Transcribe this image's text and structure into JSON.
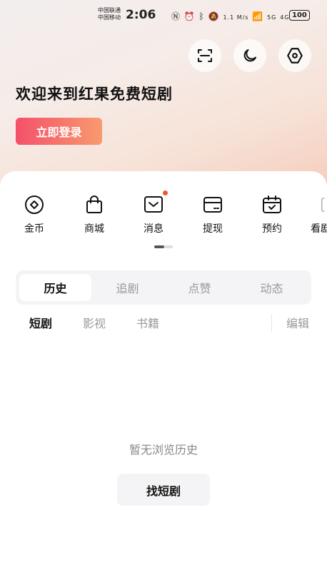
{
  "status_bar": {
    "carrier_1": "中国联通",
    "carrier_2": "中国移动",
    "time": "2:06",
    "speed": "1.1 M/s",
    "net_1": "5G",
    "net_2": "4G",
    "battery": "100"
  },
  "header": {
    "icons": [
      "scan-icon",
      "moon-icon",
      "settings-icon"
    ]
  },
  "welcome_text": "欢迎来到红果免费短剧",
  "login_label": "立即登录",
  "quick_actions": [
    {
      "label": "金币",
      "icon": "coin-icon"
    },
    {
      "label": "商城",
      "icon": "shopping-bag-icon"
    },
    {
      "label": "消息",
      "icon": "message-icon",
      "badge": true
    },
    {
      "label": "提现",
      "icon": "wallet-icon"
    },
    {
      "label": "预约",
      "icon": "calendar-icon"
    },
    {
      "label": "看剧",
      "icon": "tv-icon"
    }
  ],
  "tabs": [
    "历史",
    "追剧",
    "点赞",
    "动态"
  ],
  "active_tab": "历史",
  "sub_tabs": [
    "短剧",
    "影视",
    "书籍"
  ],
  "active_sub_tab": "短剧",
  "edit_label": "编辑",
  "empty_text": "暂无浏览历史",
  "find_button": "找短剧",
  "colors": {
    "accent_start": "#f4506b",
    "accent_end": "#f89a6e",
    "badge": "#f4562e"
  }
}
